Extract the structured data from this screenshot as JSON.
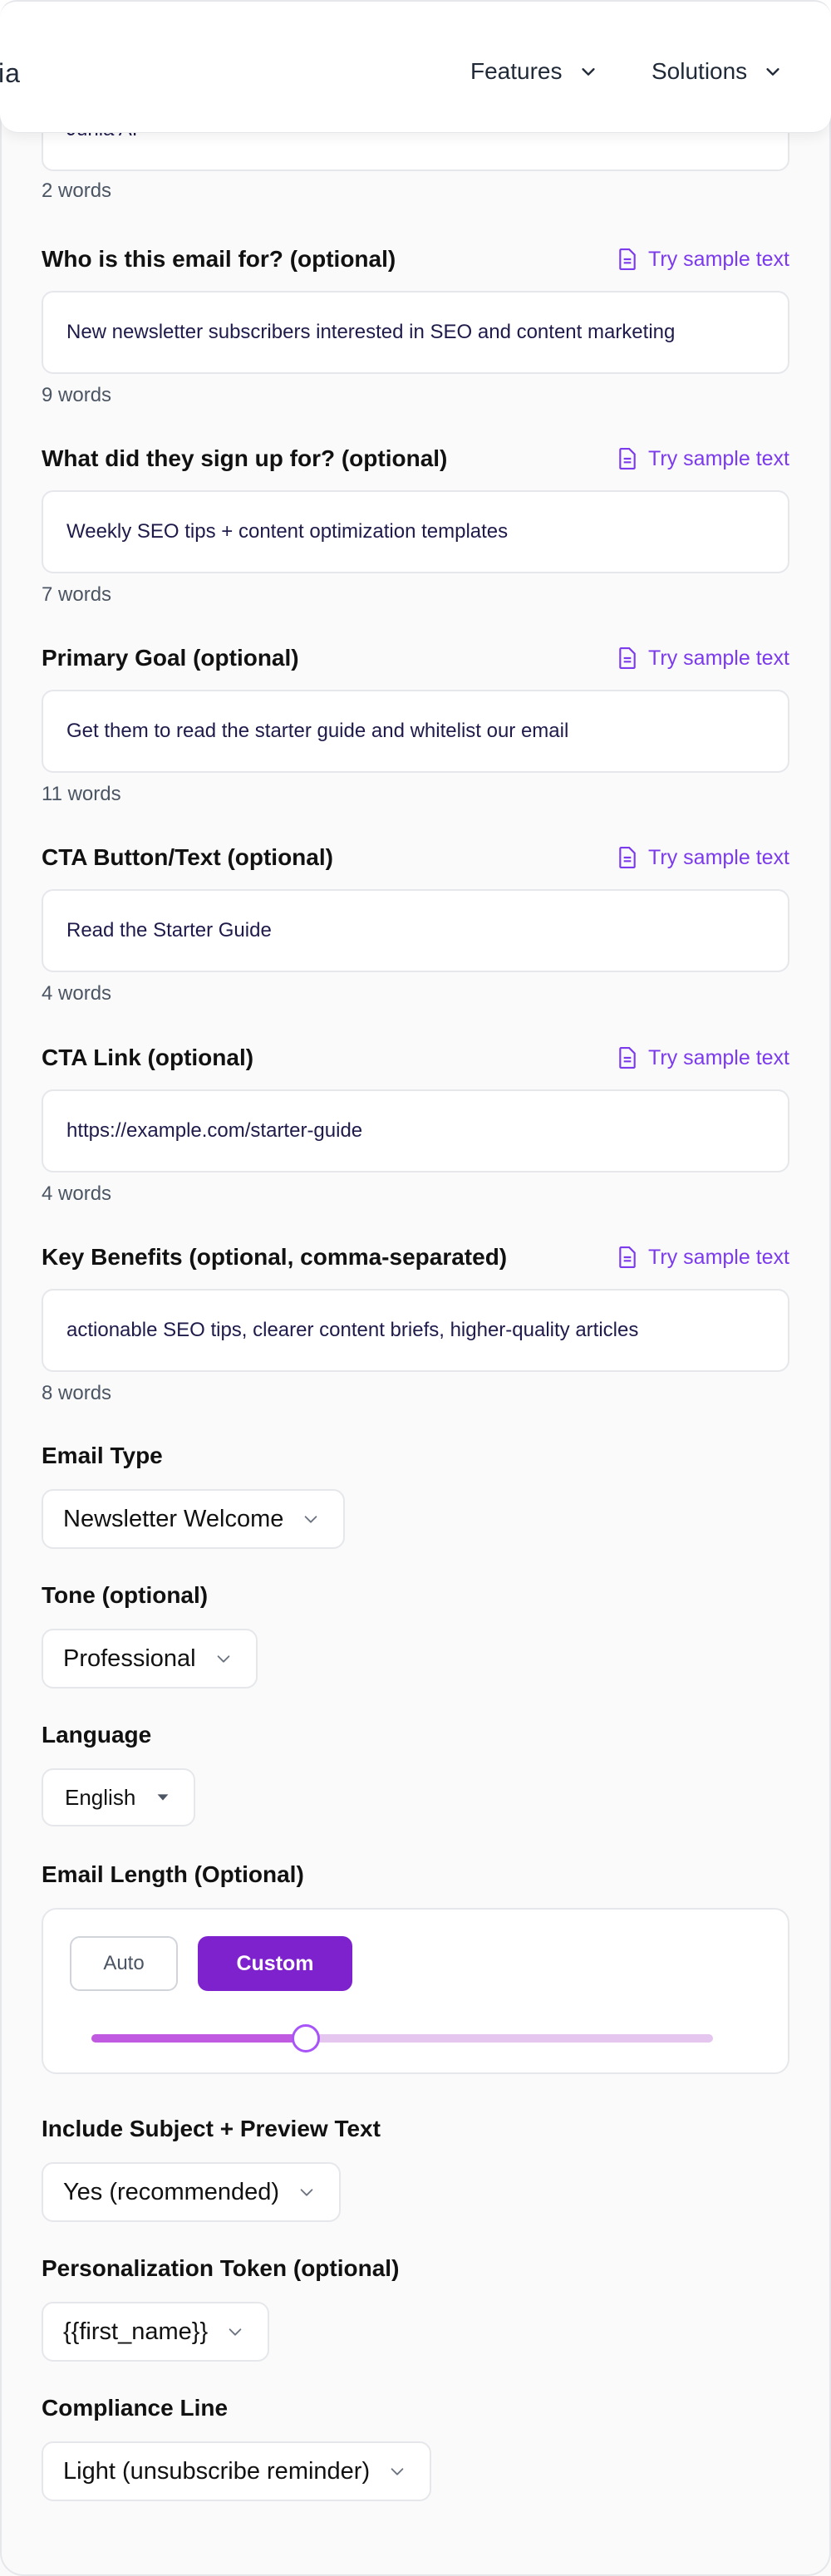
{
  "header": {
    "brand": "ia",
    "nav": [
      {
        "label": "Features"
      },
      {
        "label": "Solutions"
      }
    ]
  },
  "top_partial": {
    "value": "Junia AI",
    "count": "2 words"
  },
  "try_sample_label": "Try sample text",
  "fields": [
    {
      "label": "Who is this email for? (optional)",
      "value": "New newsletter subscribers interested in SEO and content marketing",
      "count": "9 words"
    },
    {
      "label": "What did they sign up for? (optional)",
      "value": "Weekly SEO tips + content optimization templates",
      "count": "7 words"
    },
    {
      "label": "Primary Goal (optional)",
      "value": "Get them to read the starter guide and whitelist our email",
      "count": "11 words"
    },
    {
      "label": "CTA Button/Text (optional)",
      "value": "Read the Starter Guide",
      "count": "4 words"
    },
    {
      "label": "CTA Link (optional)",
      "value": "https://example.com/starter-guide",
      "count": "4 words"
    },
    {
      "label": "Key Benefits (optional, comma-separated)",
      "value": "actionable SEO tips, clearer content briefs, higher-quality articles",
      "count": "8 words"
    }
  ],
  "email_type": {
    "label": "Email Type",
    "value": "Newsletter Welcome"
  },
  "tone": {
    "label": "Tone (optional)",
    "value": "Professional"
  },
  "language": {
    "label": "Language",
    "value": "English"
  },
  "email_length": {
    "label": "Email Length (Optional)",
    "auto_label": "Auto",
    "custom_label": "Custom",
    "slider_fraction": 0.345
  },
  "subject_preview": {
    "label": "Include Subject + Preview Text",
    "value": "Yes (recommended)"
  },
  "personalization": {
    "label": "Personalization Token (optional)",
    "value": "{{first_name}}"
  },
  "compliance": {
    "label": "Compliance Line",
    "value": "Light (unsubscribe reminder)"
  },
  "colors": {
    "accent": "#7c3aed",
    "button": "#7e22ce",
    "slider_fill": "#c05ae0",
    "slider_track": "#e4c6ef"
  }
}
